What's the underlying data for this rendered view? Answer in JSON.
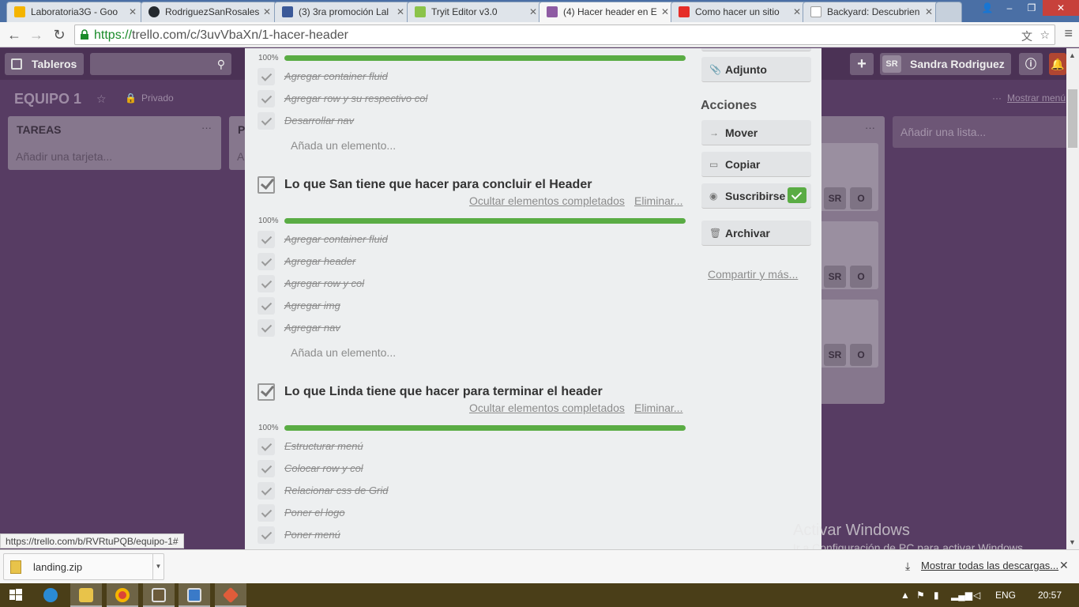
{
  "browser": {
    "tabs": [
      {
        "title": "Laboratoria3G - Goo",
        "color": "#f4b400"
      },
      {
        "title": "RodriguezSanRosales",
        "color": "#24292e"
      },
      {
        "title": "(3) 3ra promoción Lal",
        "color": "#3b5998"
      },
      {
        "title": "Tryit Editor v3.0",
        "color": "#8bc34a"
      },
      {
        "title": "(4) Hacer header en E",
        "color": "#8e5ba3"
      },
      {
        "title": "Como hacer un sitio",
        "color": "#e52d27"
      },
      {
        "title": "Backyard: Descubrien",
        "color": "#9e9e9e"
      }
    ],
    "url_scheme": "https://",
    "url_rest": "trello.com/c/3uvVbaXn/1-hacer-header",
    "status_url": "https://trello.com/b/RVRtuPQB/equipo-1#"
  },
  "trello": {
    "header": {
      "boards_label": "Tableros",
      "user_initials": "SR",
      "user_name": "Sandra Rodriguez"
    },
    "board": {
      "title": "EQUIPO 1",
      "visibility": "Privado",
      "show_menu": "Mostrar menú",
      "add_list": "Añadir una lista..."
    },
    "lists": [
      {
        "title": "TAREAS",
        "add_card": "Añadir una tarjeta..."
      },
      {
        "title": "P",
        "add_card": "A"
      }
    ],
    "card_members": {
      "initials": "SR",
      "other": "O"
    }
  },
  "modal": {
    "checklists": [
      {
        "title": "",
        "percent": "100%",
        "items": [
          "Agregar container fluid",
          "Agregar row y su respectivo col",
          "Desarrollar nav"
        ],
        "add_item": "Añada un elemento..."
      },
      {
        "title": "Lo que San tiene que hacer para concluir el Header",
        "hide_completed": "Ocultar elementos completados",
        "delete": "Eliminar...",
        "percent": "100%",
        "items": [
          "Agregar container fluid",
          "Agregar header",
          "Agregar row y col",
          "Agregar img",
          "Agregar nav"
        ],
        "add_item": "Añada un elemento..."
      },
      {
        "title": "Lo que Linda tiene que hacer para terminar el header",
        "hide_completed": "Ocultar elementos completados",
        "delete": "Eliminar...",
        "percent": "100%",
        "items": [
          "Estructurar menú",
          "Colocar row y col",
          "Relacionar css de Grid",
          "Poner el logo",
          "Poner menú"
        ]
      }
    ],
    "sidebar": {
      "attachment": "Adjunto",
      "actions_title": "Acciones",
      "move": "Mover",
      "copy": "Copiar",
      "subscribe": "Suscribirse",
      "archive": "Archivar",
      "share": "Compartir y más..."
    }
  },
  "watermark": {
    "line1": "Activar Windows",
    "line2": "Ir a Configuración de PC para activar Windows."
  },
  "downloads": {
    "file": "landing.zip",
    "show_all": "Mostrar todas las descargas..."
  },
  "taskbar": {
    "language": "ENG",
    "time": "20:57"
  }
}
